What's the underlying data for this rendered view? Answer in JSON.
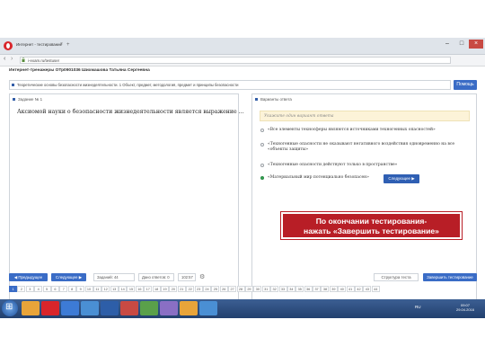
{
  "browser": {
    "tab_title": "Интернет - тестирование",
    "url": "i-exam.ru/testuser"
  },
  "header": {
    "title": "Интернет-тренажеры ОТр0901036 Шихмашова Татьяна Сергеевна"
  },
  "topic": {
    "text": "Теоретические основы безопасности жизнедеятельности. 1 Объект, предмет, методология, предмет и принципы безопасности",
    "help_label": "Помощь"
  },
  "question": {
    "header": "Задание № 1",
    "text": "Аксиомой науки о безопасности жизнедеятельности является выражение …"
  },
  "answers": {
    "header": "Варианты ответа",
    "hint": "Укажите один вариант ответа",
    "options": [
      {
        "text": "«Все элементы техносферы являются источниками техногенных опасностей»",
        "selected": false
      },
      {
        "text": "«Техногенные опасности не оказывают негативного воздействия одновременно на все «объекты защиты»",
        "selected": false
      },
      {
        "text": "«Техногенные опасности действуют только в пространстве»",
        "selected": false
      },
      {
        "text": "«Материальный мир потенциально безопасен»",
        "selected": true
      }
    ],
    "next_inline_label": "Следующее ▶"
  },
  "overlay": {
    "line1": "По окончании тестирования-",
    "line2": "нажать «Завершить тестирование»"
  },
  "bottom": {
    "prev_label": "◀ Предыдущее",
    "next_label": "Следующее ▶",
    "tasks_field": "Заданий: 44",
    "answered_field": "Дано ответов: 0",
    "time_field": "102:57",
    "structure_label": "Структура теста",
    "finish_label": "Завершить тестирование"
  },
  "pagination": {
    "pages": [
      "1",
      "2",
      "3",
      "4",
      "5",
      "6",
      "7",
      "8",
      "9",
      "10",
      "11",
      "12",
      "13",
      "14",
      "15",
      "16",
      "17",
      "18",
      "19",
      "20",
      "21",
      "22",
      "23",
      "24",
      "25",
      "26",
      "27",
      "28",
      "29",
      "30",
      "31",
      "32",
      "33",
      "34",
      "35",
      "36",
      "37",
      "38",
      "39",
      "40",
      "41",
      "42",
      "43",
      "44"
    ],
    "current": "1"
  },
  "taskbar": {
    "lang": "RU",
    "time": "09:07",
    "date": "29.04.2016"
  },
  "colors": {
    "accent": "#3a6cc6",
    "overlay": "#b81e26",
    "selected": "#34a853",
    "hint_bg": "#fcf3d8"
  }
}
